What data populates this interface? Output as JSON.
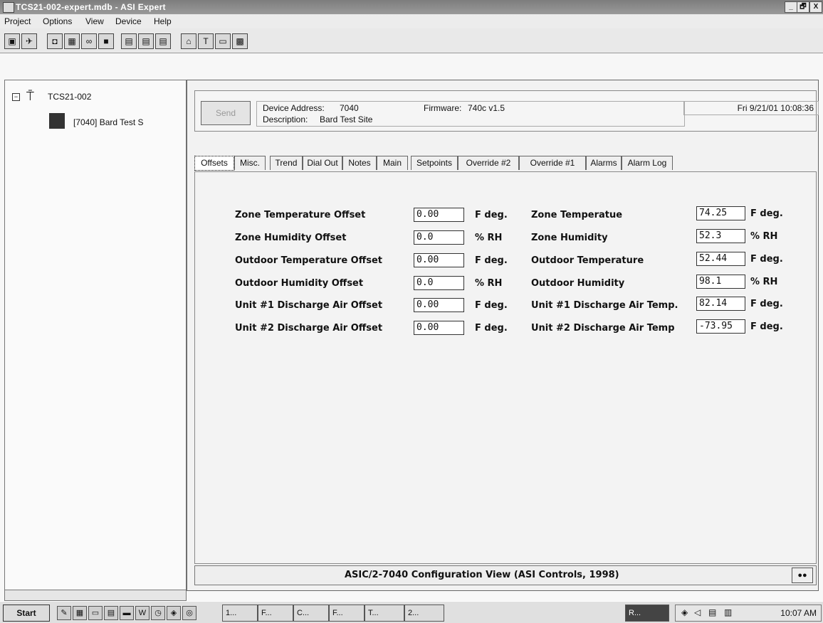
{
  "window": {
    "title": "TCS21-002-expert.mdb - ASI Expert",
    "controls": [
      "_",
      "🗗",
      "X"
    ]
  },
  "menu": [
    "Project",
    "Options",
    "View",
    "Device",
    "Help"
  ],
  "toolbar": {
    "icons": [
      "connect-icon",
      "satellite-icon",
      "capture-icon",
      "image-icon",
      "binoculars-icon",
      "book-icon",
      "save-icon",
      "save-all-icon",
      "save-as-icon",
      "home-icon",
      "tools-icon",
      "monitor-icon",
      "grid-icon"
    ]
  },
  "tree": {
    "root": "TCS21-002",
    "child": "[7040] Bard Test S"
  },
  "device": {
    "send_label": "Send",
    "address_label": "Device Address:",
    "address": "7040",
    "firmware_label": "Firmware:",
    "firmware": "740c v1.5",
    "description_label": "Description:",
    "description": "Bard Test Site",
    "datetime": "Fri  9/21/01  10:08:36"
  },
  "tabs": [
    "Offsets",
    "Misc.",
    "Trend",
    "Dial Out",
    "Notes",
    "Main",
    "Setpoints",
    "Override #2",
    "Override #1",
    "Alarms",
    "Alarm Log"
  ],
  "offsets": [
    {
      "label": "Zone Temperature Offset",
      "value": "0.00",
      "unit": "F deg."
    },
    {
      "label": "Zone Humidity Offset",
      "value": "0.0",
      "unit": "% RH"
    },
    {
      "label": "Outdoor Temperature Offset",
      "value": "0.00",
      "unit": "F deg."
    },
    {
      "label": "Outdoor Humidity Offset",
      "value": "0.0",
      "unit": "% RH"
    },
    {
      "label": "Unit #1 Discharge Air Offset",
      "value": "0.00",
      "unit": "F deg."
    },
    {
      "label": "Unit #2 Discharge Air Offset",
      "value": "0.00",
      "unit": "F deg."
    }
  ],
  "readings": [
    {
      "label": "Zone Temperatue",
      "value": "74.25",
      "unit": "F deg."
    },
    {
      "label": "Zone Humidity",
      "value": "52.3",
      "unit": "% RH"
    },
    {
      "label": "Outdoor Temperature",
      "value": "52.44",
      "unit": "F deg."
    },
    {
      "label": "Outdoor Humidity",
      "value": "98.1",
      "unit": "% RH"
    },
    {
      "label": "Unit #1 Discharge Air Temp.",
      "value": "82.14",
      "unit": "F deg."
    },
    {
      "label": "Unit #2 Discharge Air Temp",
      "value": "-73.95",
      "unit": "F deg."
    }
  ],
  "status": {
    "text": "ASIC/2-7040 Configuration View (ASI Controls, 1998)",
    "icon": "connection-icon"
  },
  "taskbar": {
    "start": "Start",
    "tasks": [
      "1...",
      "F...",
      "C...",
      "F...",
      "T...",
      "2...",
      "R..."
    ],
    "clock": "10:07 AM"
  }
}
